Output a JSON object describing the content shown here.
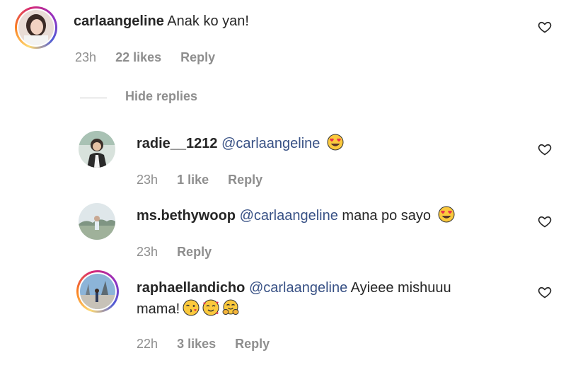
{
  "comments": [
    {
      "username": "carlaangeline",
      "mention": "",
      "text": "Anak ko yan!",
      "time": "23h",
      "likes": "22 likes",
      "reply": "Reply"
    },
    {
      "username": "radie__1212",
      "mention": "@carlaangeline",
      "text": "",
      "emoji": [
        "heart-eyes-emoji"
      ],
      "time": "23h",
      "likes": "1 like",
      "reply": "Reply"
    },
    {
      "username": "ms.bethywoop",
      "mention": "@carlaangeline",
      "text": "mana po sayo",
      "emoji": [
        "heart-eyes-emoji"
      ],
      "time": "23h",
      "likes": "",
      "reply": "Reply"
    },
    {
      "username": "raphaellandicho",
      "mention": "@carlaangeline",
      "text": "Ayieee mishuuu",
      "text_line2": "mama!",
      "emoji": [
        "kissing-wink-emoji",
        "smiling-hearts-emoji",
        "hugging-emoji"
      ],
      "time": "22h",
      "likes": "3 likes",
      "reply": "Reply"
    }
  ],
  "hide_replies_label": "Hide replies",
  "icons": {
    "like": "heart-outline-icon"
  },
  "colors": {
    "mention": "#385185",
    "meta": "#8e8e8e",
    "emoji_face": "#fbc93d",
    "emoji_heart": "#e8304a"
  }
}
